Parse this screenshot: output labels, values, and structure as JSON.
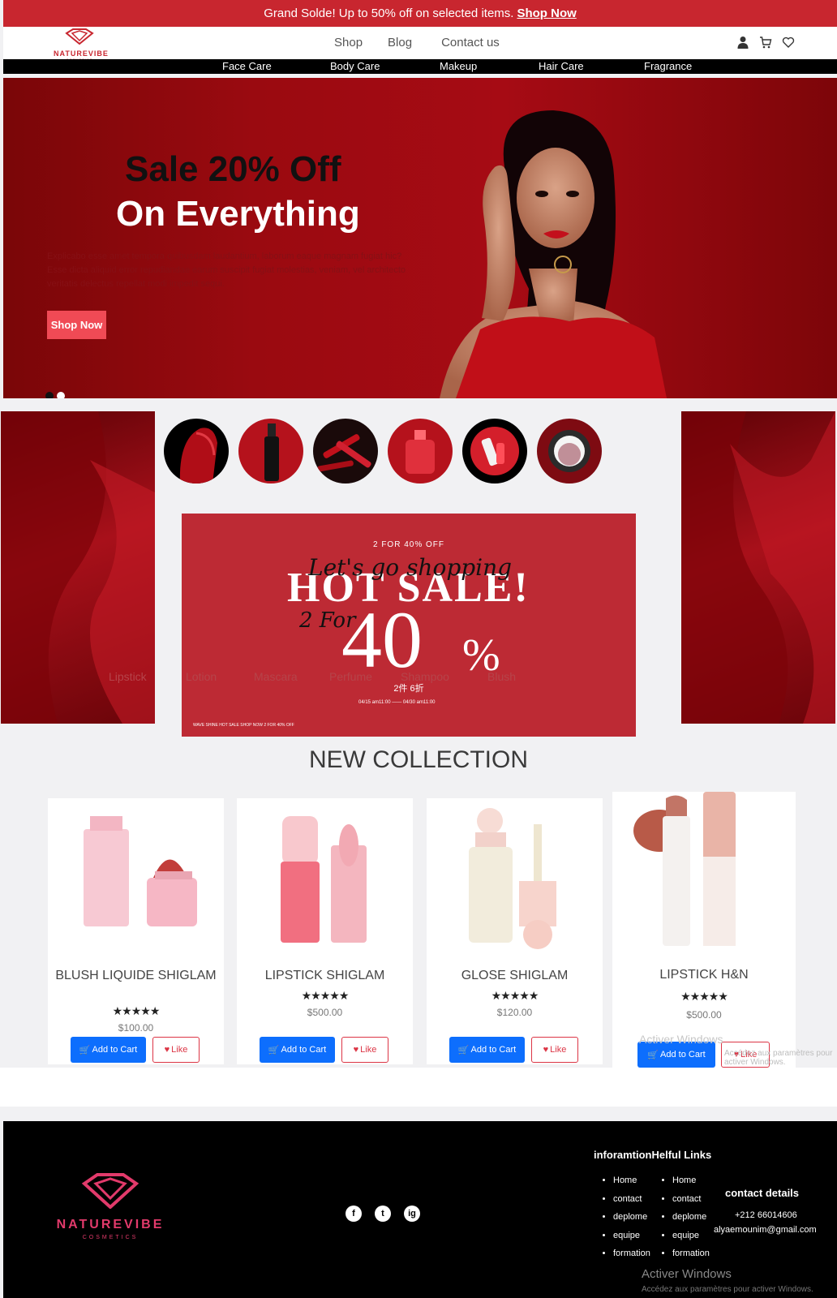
{
  "announcement": {
    "text": "Grand Solde! Up to 50% off on selected items.",
    "link": "Shop Now"
  },
  "brand": {
    "name": "NATUREVIBE",
    "tagline": "COSMETICS"
  },
  "nav": {
    "links": [
      "Shop",
      "Blog",
      "Contact us"
    ]
  },
  "categories_bar": [
    "Face Care",
    "Body Care",
    "Makeup",
    "Hair Care",
    "Fragrance"
  ],
  "hero": {
    "title": "Sale 20% Off",
    "subtitle": "On Everything",
    "body": "Explicabo esse amet tempora quibusdam laudantium, laborum eaque magnam fugiat hic? Esse dicta aliquid error repudiandae earum suscipit fugiat molestias, veniam, vel architecto veritatis delectus repellat modi impedit sequi.",
    "button": "Shop Now"
  },
  "category_circles": [
    "Lipstick",
    "Lotion",
    "Mascara",
    "Perfume",
    "Shampoo",
    "Blush"
  ],
  "promo": {
    "top": "2 FOR 40% OFF",
    "script": "Let's go shopping",
    "headline": "HOT SALE!",
    "two_for": "2 For",
    "big": "40",
    "percent": "%",
    "chinese": "2件 6折",
    "dates": "04/15  am11:00  ——  04/30  am11:00",
    "fineprint": "WAVE SHINE HOT SALE SHOP NOW 2 FOR 40% OFF"
  },
  "collection": {
    "title": "NEW COLLECTION",
    "products": [
      {
        "name": "BLUSH LIQUIDE SHIGLAM",
        "stars": "★★★★★",
        "price": "$100.00",
        "cart": "Add to Cart",
        "like": "Like"
      },
      {
        "name": "LIPSTICK SHIGLAM",
        "stars": "★★★★★",
        "price": "$500.00",
        "cart": "Add to Cart",
        "like": "Like"
      },
      {
        "name": "GLOSE SHIGLAM",
        "stars": "★★★★★",
        "price": "$120.00",
        "cart": "Add to Cart",
        "like": "Like"
      },
      {
        "name": "LIPSTICK H&N",
        "stars": "★★★★★",
        "price": "$500.00",
        "cart": "Add to Cart",
        "like": "Like"
      }
    ]
  },
  "footer": {
    "links_title": "inforamtionHelful Links",
    "col1": [
      "Home",
      "contact",
      "deplome",
      "equipe",
      "formation"
    ],
    "col2": [
      "Home",
      "contact",
      "deplome",
      "equipe",
      "formation"
    ],
    "contact_title": "contact details",
    "phone": "+212 66014606",
    "email": "alyaemounim@gmail.com",
    "social": [
      "f",
      "t",
      "ig"
    ]
  },
  "watermark": {
    "line1": "Activer Windows",
    "line2": "Accédez aux paramètres pour activer Windows."
  },
  "colors": {
    "primary": "#c8262f",
    "hero_bg": "#9a0a10",
    "button_blue": "#0d6efd",
    "like_red": "#dc3545"
  }
}
